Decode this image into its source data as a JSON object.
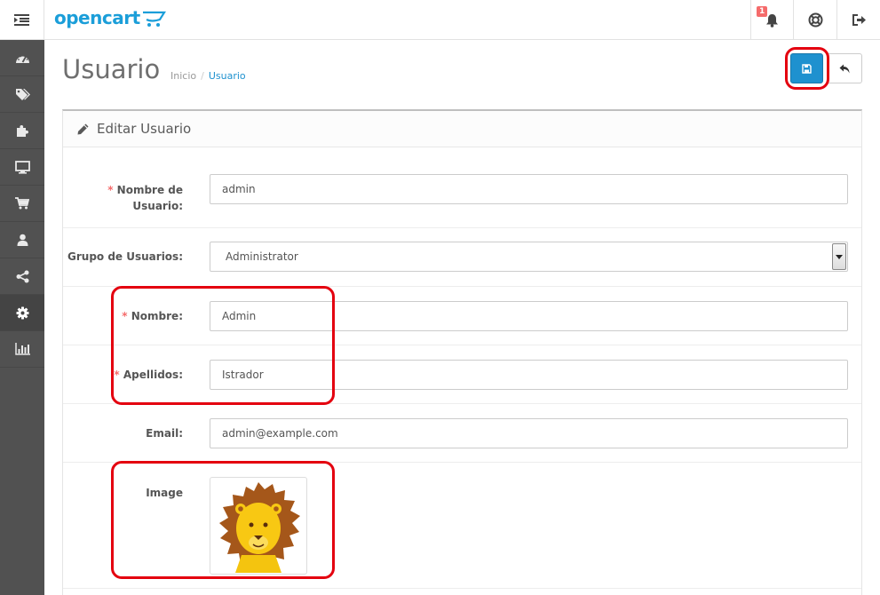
{
  "header": {
    "logo_text": "opencart",
    "notification_count": "1"
  },
  "sidebar": {
    "items": [
      {
        "icon": "dashboard-icon"
      },
      {
        "icon": "tags-icon"
      },
      {
        "icon": "puzzle-icon"
      },
      {
        "icon": "desktop-icon"
      },
      {
        "icon": "cart-icon"
      },
      {
        "icon": "user-icon"
      },
      {
        "icon": "share-icon"
      },
      {
        "icon": "gear-icon"
      },
      {
        "icon": "bar-chart-icon"
      }
    ]
  },
  "page": {
    "title": "Usuario",
    "breadcrumb": [
      "Inicio",
      "Usuario"
    ],
    "panel_title": "Editar Usuario"
  },
  "form": {
    "username": {
      "label_line1": "Nombre de",
      "label_line2": "Usuario:",
      "value": "admin"
    },
    "user_group": {
      "label": "Grupo de Usuarios:",
      "value": "Administrator"
    },
    "firstname": {
      "label": "Nombre:",
      "value": "Admin"
    },
    "lastname": {
      "label": "Apellidos:",
      "value": "Istrador"
    },
    "email": {
      "label": "Email:",
      "value": "admin@example.com"
    },
    "image": {
      "label": "Image"
    },
    "required_mark": "*"
  },
  "colors": {
    "accent": "#1e91cf",
    "sidebar": "#515151",
    "annotation": "#e4000f",
    "required": "#f56b6b"
  }
}
